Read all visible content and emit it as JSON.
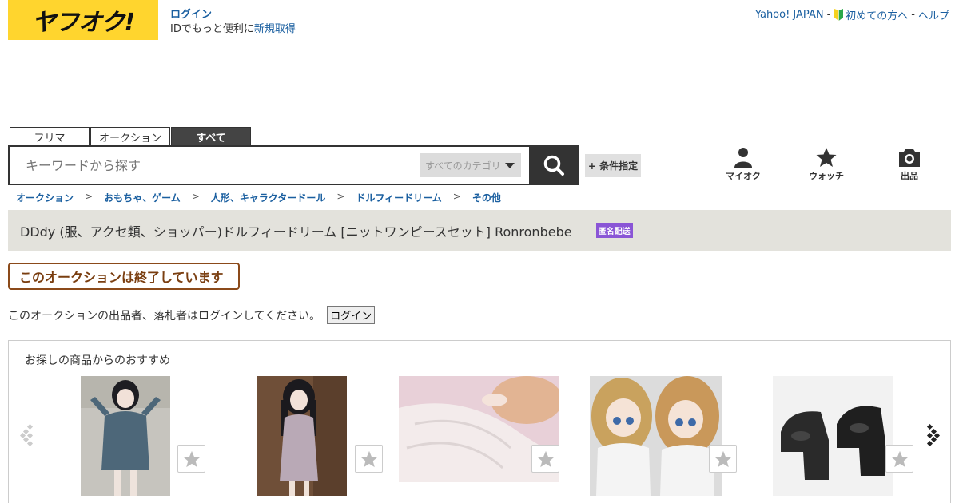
{
  "header": {
    "logo_text": "ヤフオク!",
    "login_label": "ログイン",
    "id_prompt": "IDでもっと便利に",
    "signup_label": "新規取得",
    "yahoo_japan": "Yahoo! JAPAN",
    "first_time": "初めての方へ",
    "help": "ヘルプ",
    "separator": "-"
  },
  "tabs": [
    {
      "label": "フリマ",
      "active": false
    },
    {
      "label": "オークション",
      "active": false
    },
    {
      "label": "すべて",
      "active": true
    }
  ],
  "search": {
    "placeholder": "キーワードから探す",
    "category": "すべてのカテゴリ",
    "conditions_label": "+ 条件指定"
  },
  "nav": {
    "my_auction": "マイオク",
    "watch": "ウォッチ",
    "sell": "出品"
  },
  "breadcrumb": [
    "オークション",
    "おもちゃ、ゲーム",
    "人形、キャラクタードール",
    "ドルフィードリーム",
    "その他"
  ],
  "breadcrumb_sep": ">",
  "item": {
    "title": "DDdy (服、アクセ類、ショッパー)ドルフィードリーム [ニットワンピースセット] Ronronbebe",
    "badge": "匿名配送",
    "ended_message": "このオークションは終了しています",
    "login_message": "このオークションの出品者、落札者はログインしてください。",
    "login_button": "ログイン"
  },
  "recommend": {
    "heading": "お探しの商品からのおすすめ",
    "items": [
      {
        "alt": "blue-knit-dress-doll"
      },
      {
        "alt": "lavender-knit-dress-doll"
      },
      {
        "alt": "white-lace-dress-doll"
      },
      {
        "alt": "two-dolls-white-outfits"
      },
      {
        "alt": "black-platform-shoes"
      }
    ]
  },
  "colors": {
    "brand_yellow": "#ffd52e",
    "link_blue": "#1a5fa0",
    "title_bar": "#e3e2dc",
    "ended_brown": "#8b4a1a",
    "badge_purple": "#8a55d6"
  }
}
